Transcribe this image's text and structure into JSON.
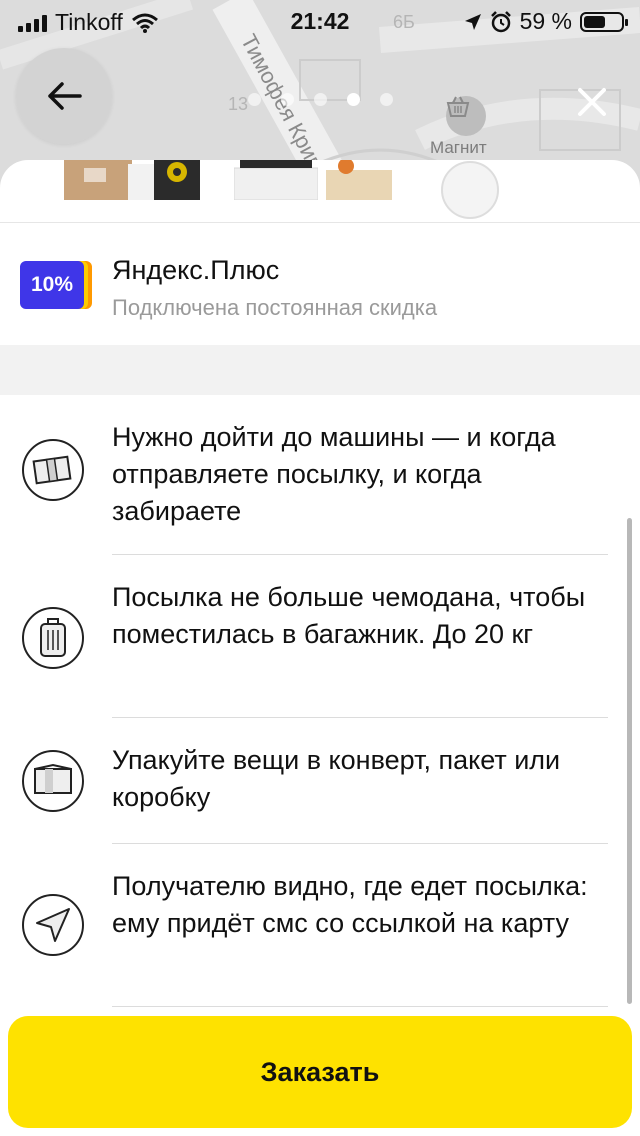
{
  "status_bar": {
    "carrier": "Tinkoff",
    "time": "21:42",
    "battery": "59 %",
    "battery_level": 0.59
  },
  "map": {
    "street_name": "Тимофея Кривова",
    "house_number_1": "13",
    "house_number_2": "6Б",
    "poi_name": "Магнит",
    "poi_icon": "shopping-basket-icon"
  },
  "carousel": {
    "total": 5,
    "active_index": 3
  },
  "nav": {
    "back_icon": "arrow-left-icon",
    "close_icon": "close-icon"
  },
  "plus": {
    "badge": "10%",
    "title": "Яндекс.Плюс",
    "subtitle": "Подключена постоянная скидка",
    "badge_color": "#3f36e8"
  },
  "info_items": [
    {
      "icon": "parcel-icon",
      "text": "Нужно дойти до машины — и когда отправляете посылку, и когда забираете"
    },
    {
      "icon": "suitcase-icon",
      "text": "Посылка не больше чемодана, чтобы поместилась в багажник. До 20 кг"
    },
    {
      "icon": "package-icon",
      "text": "Упакуйте вещи в конверт, пакет или коробку"
    },
    {
      "icon": "navigation-icon",
      "text": "Получателю видно, где едет посылка: ему придёт смс со ссылкой на карту"
    }
  ],
  "order_button": {
    "label": "Заказать",
    "color": "#fee200"
  }
}
